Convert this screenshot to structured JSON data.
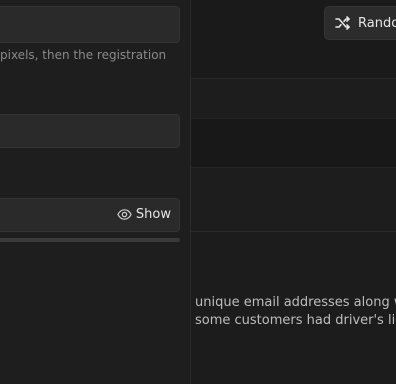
{
  "form": {
    "hint": "pixels, then the registration",
    "password_toggle_label": "Show",
    "strength_level": 0
  },
  "toolbar": {
    "random_label": "Rando"
  },
  "description": {
    "line1": "unique email addresses along w",
    "line2": "some customers had driver's lice"
  },
  "icons": {
    "random": "shuffle-icon",
    "toggle": "eye-icon"
  }
}
